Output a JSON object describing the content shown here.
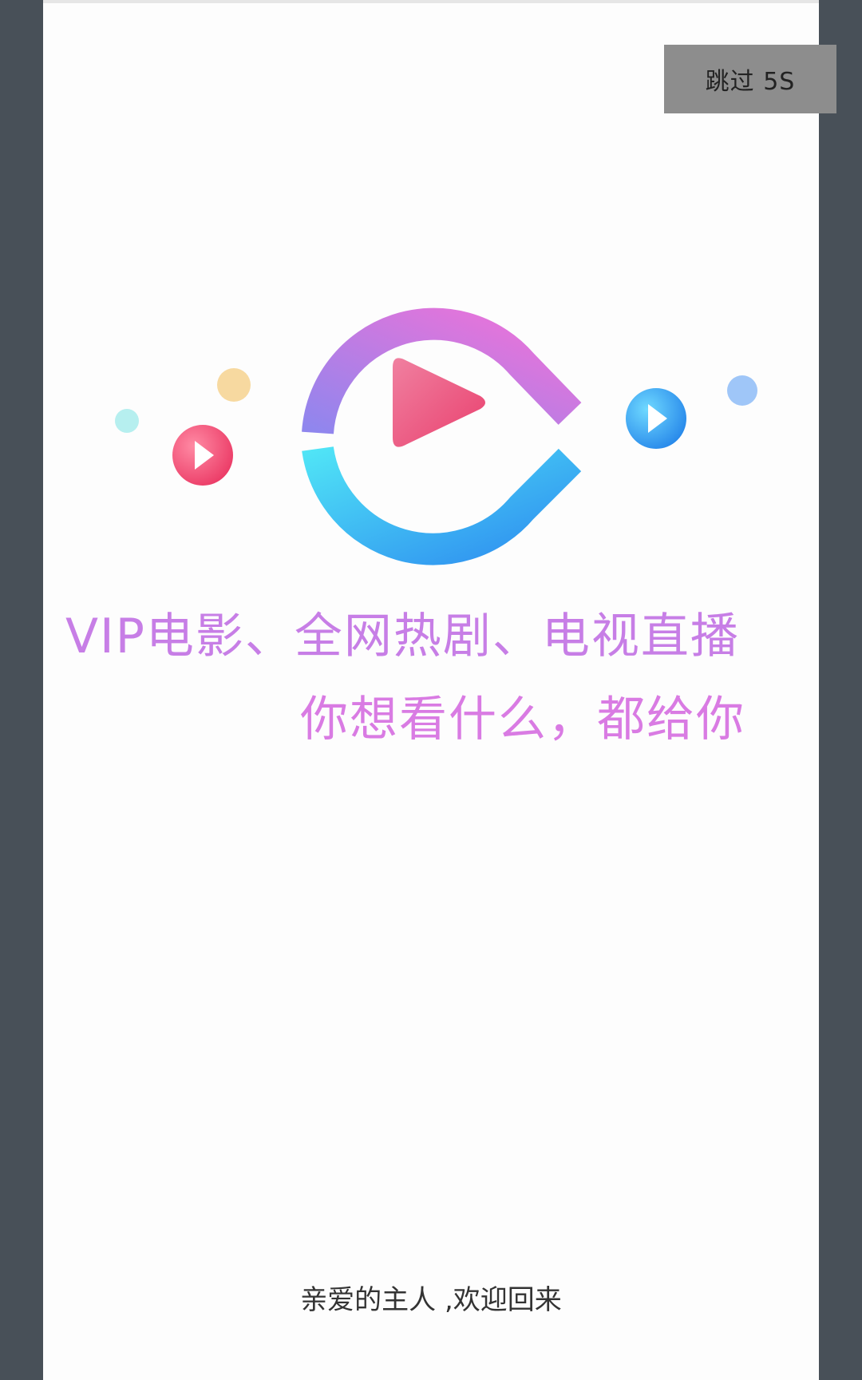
{
  "skip_button": {
    "label": "跳过 5S"
  },
  "slogan": {
    "line1": "VIP电影、全网热剧、电视直播",
    "line2": "你想看什么，都给你"
  },
  "welcome_text": "亲爱的主人 ,欢迎回来",
  "icons": [
    "logo-play-icon",
    "small-play-icon-red",
    "small-play-icon-blue",
    "decorative-dot"
  ],
  "colors": {
    "accent_purple": "#c77ee6",
    "accent_pink": "#e94e78",
    "accent_cyan": "#4fd8f5",
    "accent_blue": "#2f8ff2",
    "skip_bg": "#8d8d8d"
  }
}
